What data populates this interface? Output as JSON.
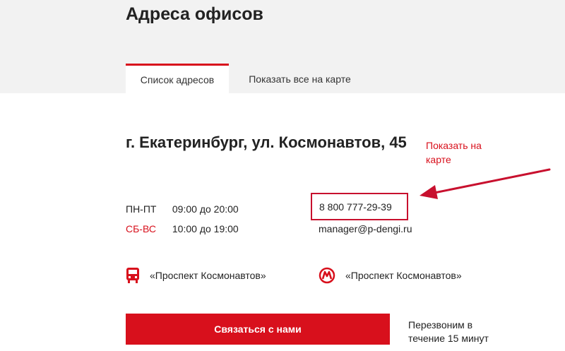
{
  "page": {
    "title": "Адреса офисов"
  },
  "tabs": [
    {
      "label": "Список адресов",
      "active": true
    },
    {
      "label": "Показать все на карте",
      "active": false
    }
  ],
  "office": {
    "address": "г. Екатеринбург, ул. Космонавтов, 45",
    "show_on_map": "Показать на карте",
    "hours": [
      {
        "days": "ПН-ПТ",
        "time": "09:00 до 20:00"
      },
      {
        "days": "СБ-ВС",
        "time": "10:00 до 19:00"
      }
    ],
    "phone": "8 800 777-29-39",
    "email": "manager@p-dengi.ru",
    "bus_stop": "«Проспект Космонавтов»",
    "metro_station": "«Проспект Космонавтов»"
  },
  "actions": {
    "contact_label": "Связаться с нами",
    "callback_note": "Перезвоним в течение 15 минут"
  },
  "colors": {
    "accent": "#d8101c",
    "highlight_box": "#c8102e",
    "band": "#f2f2f2"
  },
  "icons": {
    "bus": "bus-icon",
    "metro": "metro-icon",
    "annotation": "arrow-icon"
  }
}
